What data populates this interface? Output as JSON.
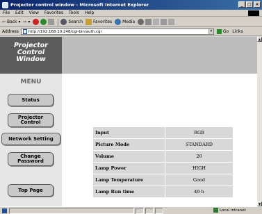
{
  "window": {
    "title": "Projector control window - Microsoft Internet Explorer",
    "buttons": [
      "_",
      "□",
      "×"
    ]
  },
  "menubar": [
    "File",
    "Edit",
    "View",
    "Favorites",
    "Tools",
    "Help"
  ],
  "toolbar": {
    "back": "Back",
    "forward": "",
    "search": "Search",
    "favorites": "Favorites",
    "media": "Media"
  },
  "address": {
    "label": "Address",
    "url": "http://192.168.10.248/cgi-bin/auth.cgi",
    "go": "Go",
    "links": "Links"
  },
  "logo": {
    "line1": "Projector",
    "line2": "Control",
    "line3": "Window"
  },
  "menu": {
    "title": "MENU",
    "items": [
      "Status",
      "Projector Control",
      "Network Setting",
      "Change Password"
    ],
    "top_page": "Top Page"
  },
  "status_table": [
    {
      "label": "Input",
      "value": "RGB"
    },
    {
      "label": "Picture Mode",
      "value": "STANDARD"
    },
    {
      "label": "Volume",
      "value": "20"
    },
    {
      "label": "Lamp Power",
      "value": "HIGH"
    },
    {
      "label": "Lamp Temperature",
      "value": "Good"
    },
    {
      "label": "Lamp Run time",
      "value": "49 h"
    }
  ],
  "statusbar": {
    "zone": "Local intranet"
  },
  "colors": {
    "titlebar": "#0a246a",
    "header_band": "#bcbcbc",
    "logo_bg": "#5c5c5c",
    "sidebar": "#e6e6e6",
    "cell": "#d8d8d8"
  }
}
